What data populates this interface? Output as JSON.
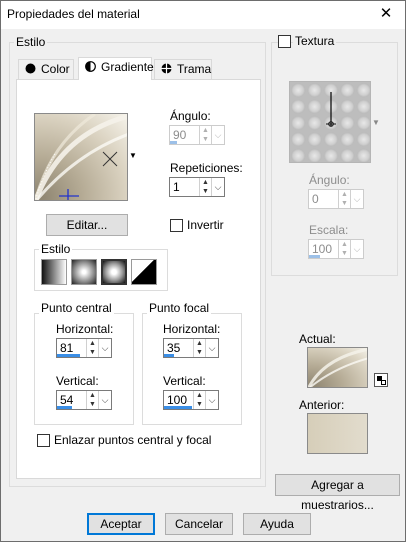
{
  "window": {
    "title": "Propiedades del material",
    "close_glyph": "✕"
  },
  "left": {
    "group_label": "Estilo",
    "tabs": [
      {
        "label": "Color",
        "icon": "filled-circle-icon"
      },
      {
        "label": "Gradiente",
        "icon": "half-circle-icon"
      },
      {
        "label": "Trama",
        "icon": "globe-pattern-icon"
      }
    ],
    "active_tab": "Gradiente",
    "angle": {
      "label": "Ángulo:",
      "value": "90",
      "enabled": false,
      "level": 0.25
    },
    "repetitions": {
      "label": "Repeticiones:",
      "value": "1",
      "level": 0.0
    },
    "edit_button": "Editar...",
    "invert": {
      "label": "Invertir",
      "checked": false
    },
    "style_group": {
      "label": "Estilo",
      "options": [
        "linear",
        "rectangular",
        "sunburst",
        "radial"
      ],
      "selected": "sunburst"
    },
    "center_point": {
      "label": "Punto central",
      "horizontal": {
        "label": "Horizontal:",
        "value": "81",
        "level": 0.81
      },
      "vertical": {
        "label": "Vertical:",
        "value": "54",
        "level": 0.54
      }
    },
    "focal_point": {
      "label": "Punto focal",
      "horizontal": {
        "label": "Horizontal:",
        "value": "35",
        "level": 0.35
      },
      "vertical": {
        "label": "Vertical:",
        "value": "100",
        "level": 1.0
      }
    },
    "link_points": {
      "label": "Enlazar puntos central y focal",
      "checked": false
    }
  },
  "right": {
    "texture": {
      "label": "Textura",
      "checked": false
    },
    "angle": {
      "label": "Ángulo:",
      "value": "0",
      "enabled": false,
      "level": 0.0
    },
    "scale": {
      "label": "Escala:",
      "value": "100",
      "enabled": false,
      "level": 0.4
    },
    "current_label": "Actual:",
    "previous_label": "Anterior:",
    "add_swatches_button": "Agregar a muestrarios..."
  },
  "footer": {
    "ok": "Aceptar",
    "cancel": "Cancelar",
    "help": "Ayuda"
  },
  "colors": {
    "accent": "#0078d7",
    "bar": "#3a8ee6",
    "gradient_light": "#f2efe6",
    "gradient_dark": "#a39a82"
  }
}
